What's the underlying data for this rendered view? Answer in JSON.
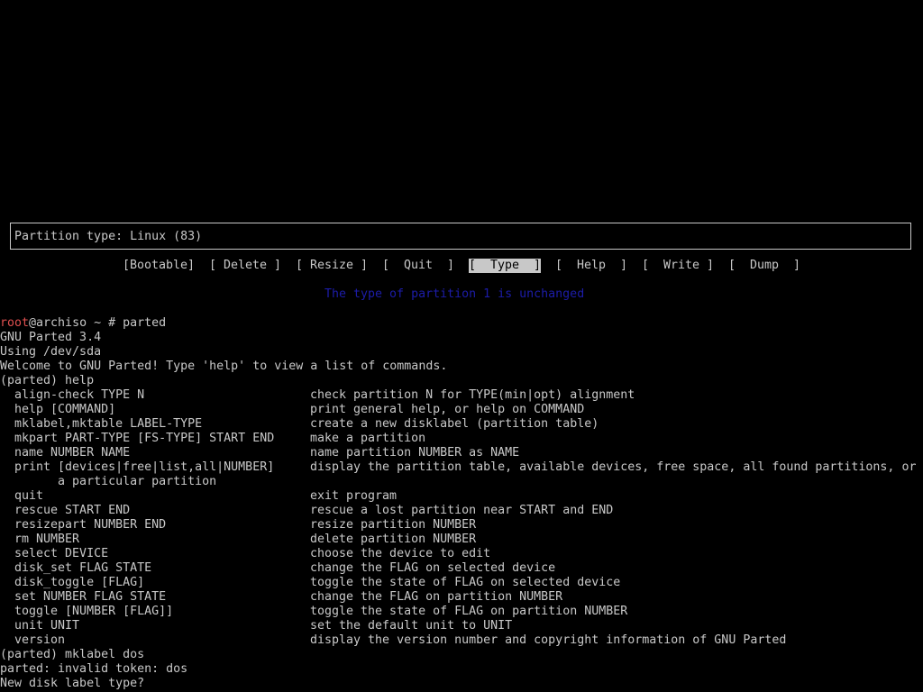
{
  "cfdisk": {
    "status_text": "Partition type: Linux (83)",
    "menu": [
      {
        "label": "[Bootable]"
      },
      {
        "label": "[ Delete ]"
      },
      {
        "label": "[ Resize ]"
      },
      {
        "label": "[  Quit  ]"
      },
      {
        "label": "[  Type  ]",
        "selected": true
      },
      {
        "label": "[  Help  ]"
      },
      {
        "label": "[  Write ]"
      },
      {
        "label": "[  Dump  ]"
      }
    ],
    "hint": "The type of partition 1 is unchanged"
  },
  "terminal": {
    "prompt_user": "root",
    "prompt_rest": "@archiso ~ # parted",
    "lines": [
      "GNU Parted 3.4",
      "Using /dev/sda",
      "Welcome to GNU Parted! Type 'help' to view a list of commands.",
      "(parted) help"
    ],
    "help_rows": [
      {
        "cmd": "  align-check TYPE N",
        "desc": "check partition N for TYPE(min|opt) alignment"
      },
      {
        "cmd": "  help [COMMAND]",
        "desc": "print general help, or help on COMMAND"
      },
      {
        "cmd": "  mklabel,mktable LABEL-TYPE",
        "desc": "create a new disklabel (partition table)"
      },
      {
        "cmd": "  mkpart PART-TYPE [FS-TYPE] START END",
        "desc": "make a partition"
      },
      {
        "cmd": "  name NUMBER NAME",
        "desc": "name partition NUMBER as NAME"
      },
      {
        "cmd": "  print [devices|free|list,all|NUMBER]",
        "desc": "display the partition table, available devices, free space, all found partitions, or"
      },
      {
        "cmd": "        a particular partition",
        "desc": ""
      },
      {
        "cmd": "  quit",
        "desc": "exit program"
      },
      {
        "cmd": "  rescue START END",
        "desc": "rescue a lost partition near START and END"
      },
      {
        "cmd": "  resizepart NUMBER END",
        "desc": "resize partition NUMBER"
      },
      {
        "cmd": "  rm NUMBER",
        "desc": "delete partition NUMBER"
      },
      {
        "cmd": "  select DEVICE",
        "desc": "choose the device to edit"
      },
      {
        "cmd": "  disk_set FLAG STATE",
        "desc": "change the FLAG on selected device"
      },
      {
        "cmd": "  disk_toggle [FLAG]",
        "desc": "toggle the state of FLAG on selected device"
      },
      {
        "cmd": "  set NUMBER FLAG STATE",
        "desc": "change the FLAG on partition NUMBER"
      },
      {
        "cmd": "  toggle [NUMBER [FLAG]]",
        "desc": "toggle the state of FLAG on partition NUMBER"
      },
      {
        "cmd": "  unit UNIT",
        "desc": "set the default unit to UNIT"
      },
      {
        "cmd": "  version",
        "desc": "display the version number and copyright information of GNU Parted"
      }
    ],
    "tail_lines": [
      "(parted) mklabel dos",
      "parted: invalid token: dos",
      "New disk label type?"
    ]
  },
  "colors": {
    "background": "#000000",
    "foreground": "#c8c8c8",
    "prompt_user": "#e05050",
    "hint": "#1c1ca8"
  }
}
